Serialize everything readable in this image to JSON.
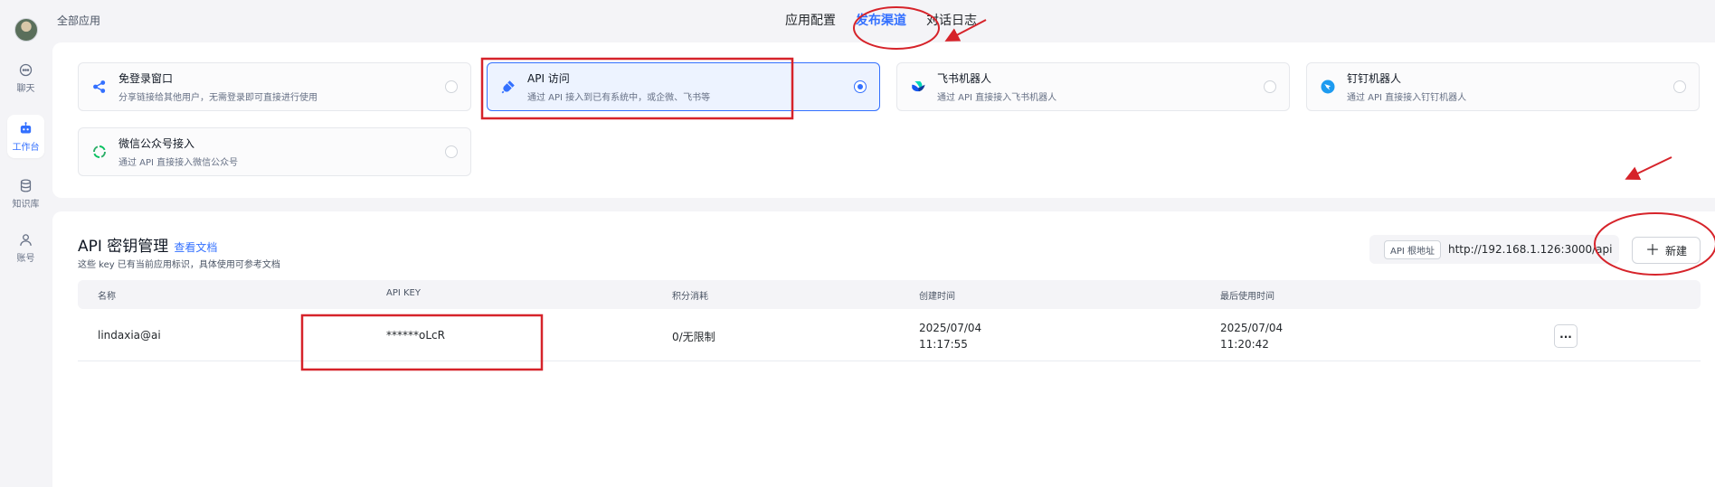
{
  "rail": {
    "items": [
      {
        "label": "聊天",
        "icon": "chat-icon",
        "active": false
      },
      {
        "label": "工作台",
        "icon": "robot-icon",
        "active": true
      },
      {
        "label": "知识库",
        "icon": "database-icon",
        "active": false
      },
      {
        "label": "账号",
        "icon": "user-icon",
        "active": false
      }
    ]
  },
  "header": {
    "breadcrumb": "全部应用",
    "tabs": [
      {
        "label": "应用配置",
        "active": false
      },
      {
        "label": "发布渠道",
        "active": true
      },
      {
        "label": "对话日志",
        "active": false
      }
    ]
  },
  "channels": [
    {
      "title": "免登录窗口",
      "desc": "分享链接给其他用户，无需登录即可直接进行使用",
      "icon": "share-icon",
      "selected": false
    },
    {
      "title": "API 访问",
      "desc": "通过 API 接入到已有系统中，或企微、飞书等",
      "icon": "api-plug-icon",
      "selected": true
    },
    {
      "title": "飞书机器人",
      "desc": "通过 API 直接接入飞书机器人",
      "icon": "feishu-icon",
      "selected": false
    },
    {
      "title": "钉钉机器人",
      "desc": "通过 API 直接接入钉钉机器人",
      "icon": "dingtalk-icon",
      "selected": false
    },
    {
      "title": "微信公众号接入",
      "desc": "通过 API 直接接入微信公众号",
      "icon": "wechat-icon",
      "selected": false
    }
  ],
  "api": {
    "title": "API 密钥管理",
    "doc_link": "查看文档",
    "subtitle": "这些 key 已有当前应用标识，具体使用可参考文档",
    "base_url_label": "API 根地址",
    "base_url": "http://192.168.1.126:3000/api",
    "new_label": "新建",
    "columns": [
      "名称",
      "API KEY",
      "积分消耗",
      "创建时间",
      "最后使用时间"
    ],
    "rows": [
      {
        "name": "lindaxia@ai",
        "key": "******oLcR",
        "usage": "0/无限制",
        "created_date": "2025/07/04",
        "created_time": "11:17:55",
        "last_date": "2025/07/04",
        "last_time": "11:20:42",
        "more": "..."
      }
    ]
  },
  "colors": {
    "accent": "#3370ff",
    "annotation": "#d6232a"
  }
}
